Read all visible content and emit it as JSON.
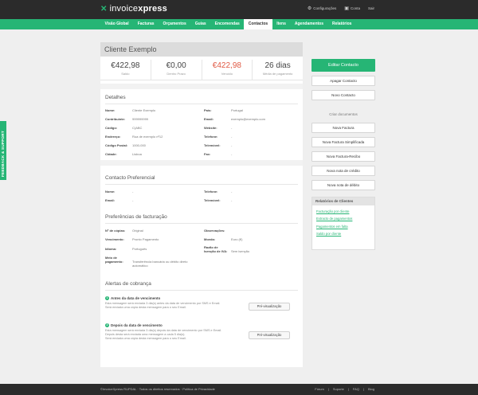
{
  "brand": {
    "logo_prefix": "invoice",
    "logo_suffix": "xpress",
    "accent": "#26b575"
  },
  "topnav": {
    "settings": "Configurações",
    "account": "Conta",
    "logout": "Sair"
  },
  "mainnav": [
    "Visão Global",
    "Facturas",
    "Orçamentos",
    "Guias",
    "Encomendas",
    "Contactos",
    "Itens",
    "Agendamentos",
    "Relatórios"
  ],
  "page_title": "Cliente Exemplo",
  "stats": [
    {
      "value": "€422,98",
      "label": "Saldo",
      "red": false
    },
    {
      "value": "€0,00",
      "label": "Dentro Prazo",
      "red": false
    },
    {
      "value": "€422,98",
      "label": "Vencido",
      "red": true
    },
    {
      "value": "26 dias",
      "label": "Média de pagamento",
      "red": false
    }
  ],
  "details": {
    "title": "Detalhes",
    "left": [
      {
        "k": "Nome:",
        "v": "Cliente Exemplo"
      },
      {
        "k": "Contribuinte:",
        "v": "999999999"
      },
      {
        "k": "Código:",
        "v": "C(ABC"
      },
      {
        "k": "Endereço:",
        "v": "Rua de exemplo nº12"
      },
      {
        "k": "Código Postal:",
        "v": "1000-000"
      },
      {
        "k": "Cidade:",
        "v": "Lisboa"
      }
    ],
    "right": [
      {
        "k": "País:",
        "v": "Portugal"
      },
      {
        "k": "Email:",
        "v": "exemplo@exemplo.com"
      },
      {
        "k": "Website:",
        "v": "-"
      },
      {
        "k": "Telefone:",
        "v": "-"
      },
      {
        "k": "Telemóvel:",
        "v": "-"
      },
      {
        "k": "Fax:",
        "v": "-"
      }
    ]
  },
  "contact": {
    "title": "Contacto Preferencial",
    "left": [
      {
        "k": "Nome:",
        "v": "-"
      },
      {
        "k": "Email:",
        "v": "-"
      }
    ],
    "right": [
      {
        "k": "Telefone:",
        "v": "-"
      },
      {
        "k": "Telemóvel:",
        "v": "-"
      }
    ]
  },
  "billing": {
    "title": "Preferências de facturação",
    "left": [
      {
        "k": "Nº de cópias:",
        "v": "Original"
      },
      {
        "k": "Vencimento:",
        "v": "Pronto Pagamento"
      },
      {
        "k": "Idioma:",
        "v": "Português"
      },
      {
        "k": "Meio de pagamento:",
        "v": "Transferência bancária ou débito direto automático"
      }
    ],
    "right": [
      {
        "k": "Observações:",
        "v": ""
      },
      {
        "k": "Moeda:",
        "v": "Euro (€)"
      },
      {
        "k": "Razão de Isenção de IVA:",
        "v": "Sem isenção"
      }
    ]
  },
  "alerts": {
    "title": "Alertas de cobrança",
    "a1": {
      "num": "1",
      "head": "Antes da data de vencimento",
      "line1": "Esta mensagem será enviada 3 dia(s) antes da data de vencimento por SMS e Email.",
      "line2": "Será enviada uma cópia desta mensagem para o seu Email.",
      "button": "Pré-visualização"
    },
    "a2": {
      "num": "2",
      "head": "Depois da data de vencimento",
      "line1": "Esta mensagem será enviada 3 dia(s) depois da data de vencimento por SMS e Email.",
      "line2": "Depois desta será enviada uma mensagem a cada 5 dia(s).",
      "line3": "Será enviada uma cópia desta mensagem para o seu Email.",
      "button": "Pré-visualização"
    }
  },
  "sidebar": {
    "edit": "Editar Contacto",
    "delete": "Apagar Contacto",
    "new_contact": "Novo Contacto",
    "create_docs": "Criar documentos",
    "docs": [
      "Nova Factura",
      "Nova Factura Simplificada",
      "Nova Factura-Recibo",
      "Nova nota de crédito",
      "Nova nota de débito"
    ],
    "reports_title": "Relatórios de Clientes",
    "reports": [
      "Facturação por cliente",
      "Extracto de pagamentos",
      "Pagamentos em falta",
      "Saldo por cliente"
    ]
  },
  "feedback": "FEEDBACK & SUPPORT",
  "footer": {
    "left": "©InvoiceXpress RUPDAL · Todos os direitos reservados · Política de Privacidade",
    "links": [
      "Fórum",
      "Suporte",
      "FAQ",
      "Blog"
    ]
  }
}
